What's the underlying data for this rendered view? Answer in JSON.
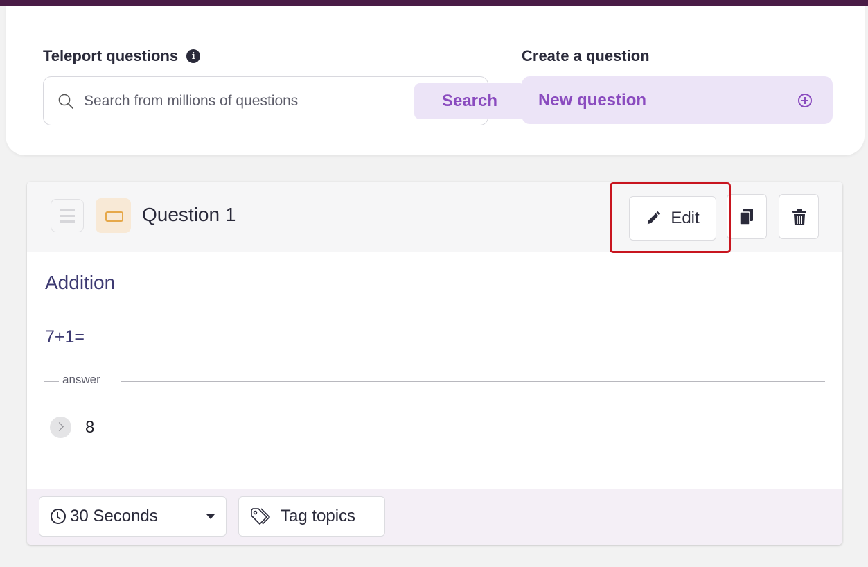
{
  "top": {
    "teleport_title": "Teleport questions",
    "info_glyph": "i",
    "search_placeholder": "Search from millions of questions",
    "search_button": "Search",
    "create_title": "Create a question",
    "new_question_label": "New question"
  },
  "question": {
    "title": "Question 1",
    "edit_label": "Edit",
    "topic": "Addition",
    "expression": "7+1=",
    "answer_label": "answer",
    "answer_value": "8",
    "time_label": "30 Seconds",
    "tag_label": "Tag topics"
  },
  "icons": {
    "info": "info-icon",
    "search": "search-icon",
    "add": "plus-circle-icon",
    "drag": "drag-handle-icon",
    "type": "question-type-icon",
    "edit": "pencil-icon",
    "duplicate": "copy-icon",
    "delete": "trash-icon",
    "time": "clock-icon",
    "tag": "tag-icon"
  },
  "colors": {
    "accent": "#8a4bbf",
    "accent_bg": "#ece4f7",
    "highlight": "#c8151f",
    "topbar": "#4a1c46"
  }
}
